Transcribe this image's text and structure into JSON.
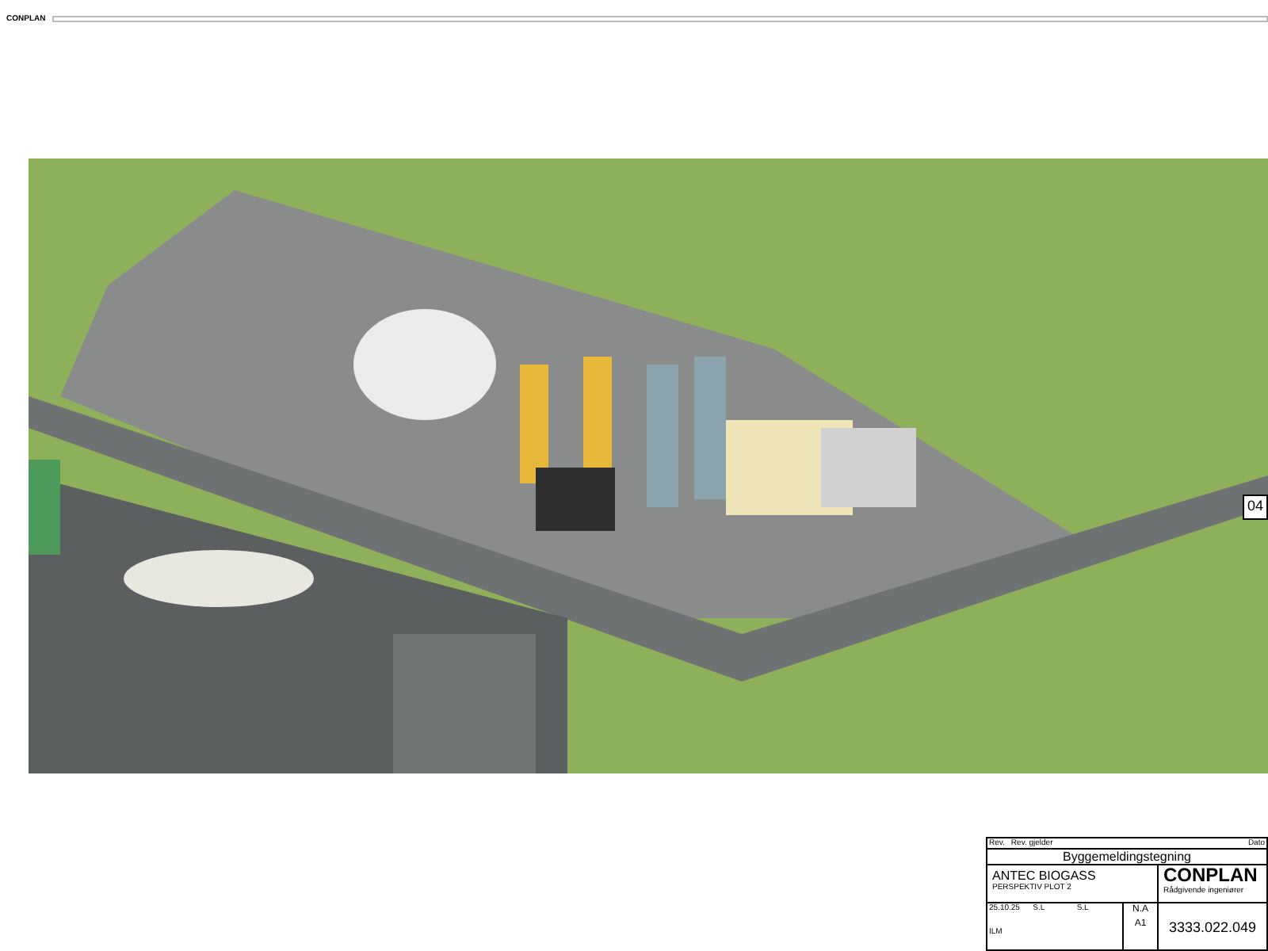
{
  "header": {
    "logo": "CONPLAN"
  },
  "render": {
    "sheet_marker": "04"
  },
  "title_block": {
    "revision_labels": [
      "Rev.",
      "Rev. gjelder",
      "Dato"
    ],
    "drawing_type": "Byggemeldingstegning",
    "project": "ANTEC BIOGASS",
    "subtitle": "PERSPEKTIV PLOT 2",
    "company": "CONPLAN",
    "company_tagline": "Rådgivende ingeniører",
    "date": "25.10.25",
    "drawn_by": "S.L",
    "checked_by": "S.L",
    "approved_by": "ILM",
    "scale": "N.A",
    "format": "A1",
    "drawing_number": "3333.022.049"
  }
}
